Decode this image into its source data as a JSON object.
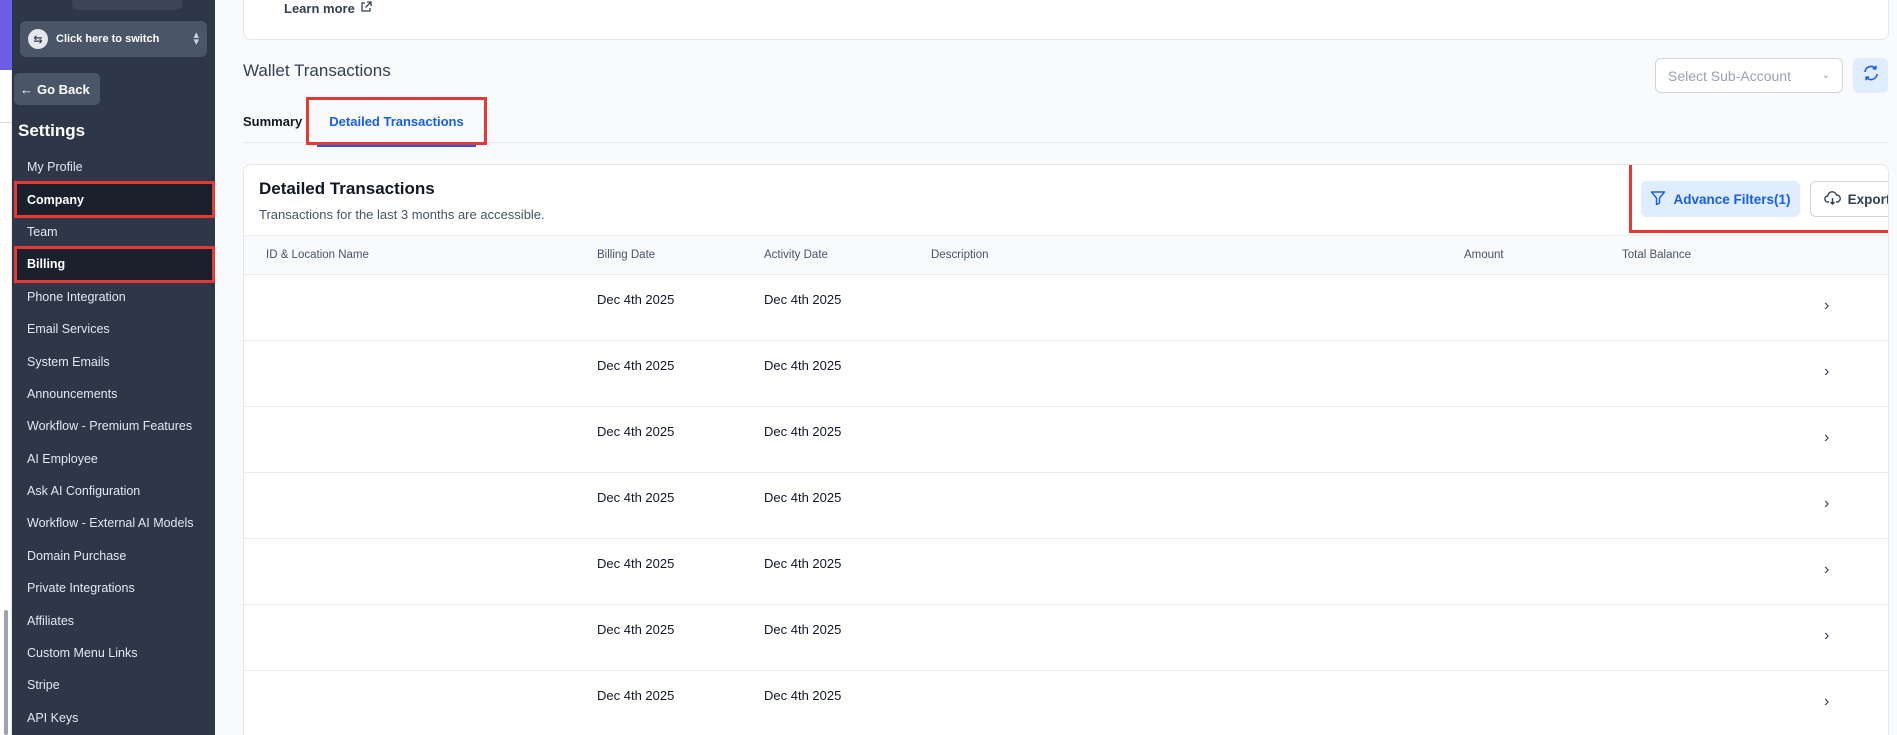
{
  "sidebar": {
    "switcher_label": "Click here to switch",
    "go_back": "Go Back",
    "title": "Settings",
    "items": [
      {
        "label": "My Profile",
        "highlighted": false
      },
      {
        "label": "Company",
        "highlighted": true
      },
      {
        "label": "Team",
        "highlighted": false
      },
      {
        "label": "Billing",
        "highlighted": true
      },
      {
        "label": "Phone Integration",
        "highlighted": false
      },
      {
        "label": "Email Services",
        "highlighted": false
      },
      {
        "label": "System Emails",
        "highlighted": false
      },
      {
        "label": "Announcements",
        "highlighted": false
      },
      {
        "label": "Workflow - Premium Features",
        "highlighted": false
      },
      {
        "label": "AI Employee",
        "highlighted": false
      },
      {
        "label": "Ask AI Configuration",
        "highlighted": false
      },
      {
        "label": "Workflow - External AI Models",
        "highlighted": false
      },
      {
        "label": "Domain Purchase",
        "highlighted": false
      },
      {
        "label": "Private Integrations",
        "highlighted": false
      },
      {
        "label": "Affiliates",
        "highlighted": false
      },
      {
        "label": "Custom Menu Links",
        "highlighted": false
      },
      {
        "label": "Stripe",
        "highlighted": false
      },
      {
        "label": "API Keys",
        "highlighted": false
      }
    ]
  },
  "main": {
    "learn_more": "Learn more",
    "wallet_title": "Wallet Transactions",
    "subaccount_placeholder": "Select Sub-Account",
    "tabs": {
      "summary": "Summary",
      "detailed": "Detailed Transactions"
    },
    "card": {
      "title": "Detailed Transactions",
      "subtitle": "Transactions for the last 3 months are accessible.",
      "filters_label": "Advance Filters(1)",
      "export_label": "Export"
    },
    "columns": [
      "ID & Location Name",
      "Billing Date",
      "Activity Date",
      "Description",
      "Amount",
      "Total Balance"
    ],
    "rows": [
      {
        "billing_date": "Dec 4th 2025",
        "activity_date": "Dec 4th 2025"
      },
      {
        "billing_date": "Dec 4th 2025",
        "activity_date": "Dec 4th 2025"
      },
      {
        "billing_date": "Dec 4th 2025",
        "activity_date": "Dec 4th 2025"
      },
      {
        "billing_date": "Dec 4th 2025",
        "activity_date": "Dec 4th 2025"
      },
      {
        "billing_date": "Dec 4th 2025",
        "activity_date": "Dec 4th 2025"
      },
      {
        "billing_date": "Dec 4th 2025",
        "activity_date": "Dec 4th 2025"
      },
      {
        "billing_date": "Dec 4th 2025",
        "activity_date": "Dec 4th 2025"
      }
    ]
  },
  "colors": {
    "sidebar_bg": "#2d3748",
    "accent_blue": "#155eef",
    "highlight_red": "#e53935",
    "brand_purple": "#6c5ce7"
  }
}
